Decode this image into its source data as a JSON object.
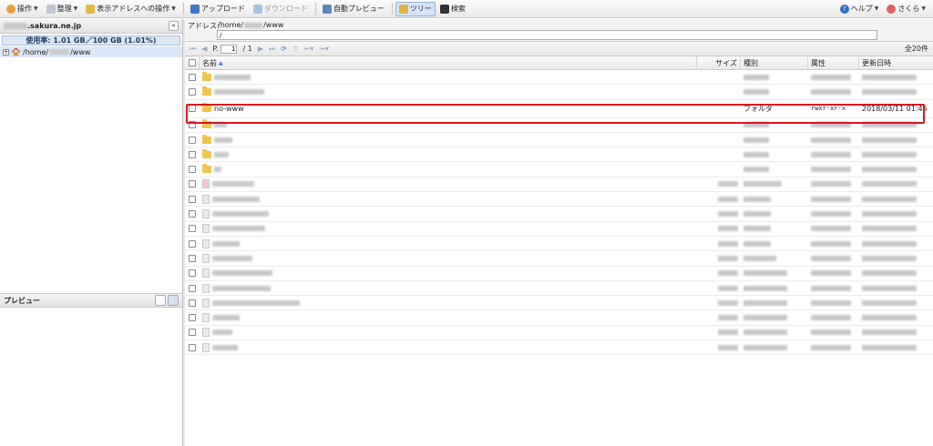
{
  "toolbar": {
    "operation": "操作",
    "organize": "整理",
    "address_ops": "表示アドレスへの操作",
    "upload": "アップロード",
    "download": "ダウンロード",
    "auto_preview": "自動プレビュー",
    "tree": "ツリー",
    "search": "検索",
    "help": "ヘルプ",
    "user": "さくら"
  },
  "left_panel": {
    "domain_suffix": ".sakura.ne.jp",
    "usage": "使用率: 1.01 GB／100 GB (1.01%)",
    "tree_root_prefix": "/home/",
    "tree_root_suffix": "/www",
    "preview_title": "プレビュー"
  },
  "address": {
    "label": "アドレス:",
    "path_prefix": "/home/",
    "path_suffix": "/www",
    "input_value": "/"
  },
  "pager": {
    "page_label": "P.",
    "page_value": "1",
    "page_total": "/ 1",
    "total": "全20件"
  },
  "columns": {
    "name": "名前",
    "size": "サイズ",
    "type": "種別",
    "attr": "属性",
    "date": "更新日時"
  },
  "highlighted_row": {
    "name": "no-www",
    "type": "フォルダ",
    "attr": "rwxr-xr-x",
    "date": "2018/03/11 01:45"
  },
  "colors": {
    "highlight_border": "#d7161c",
    "folder": "#f0c452",
    "selection": "#dbe7f7"
  }
}
